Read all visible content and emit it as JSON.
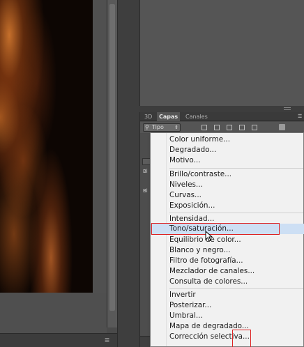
{
  "layers_panel": {
    "tabs": [
      {
        "label": "3D",
        "active": false
      },
      {
        "label": "Capas",
        "active": true
      },
      {
        "label": "Canales",
        "active": false
      }
    ],
    "filter_label": "Tipo",
    "side_labels": [
      "Bl",
      "Bl"
    ]
  },
  "adjustment_menu": {
    "highlight_color": "#cddff4",
    "annotation_color": "#dd2222",
    "groups": [
      [
        "Color uniforme...",
        "Degradado...",
        "Motivo..."
      ],
      [
        "Brillo/contraste...",
        "Niveles...",
        "Curvas...",
        "Exposición..."
      ],
      [
        "Intensidad...",
        "Tono/saturación...",
        "Equilibrio de color...",
        "Blanco y negro...",
        "Filtro de fotografía...",
        "Mezclador de canales...",
        "Consulta de colores..."
      ],
      [
        "Invertir",
        "Posterizar...",
        "Umbral...",
        "Mapa de degradado...",
        "Corrección selectiva..."
      ]
    ],
    "hovered_item": "Tono/saturación..."
  }
}
